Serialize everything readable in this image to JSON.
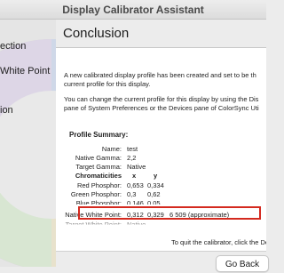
{
  "window": {
    "title": "Display Calibrator Assistant"
  },
  "sidebar": {
    "items": [
      {
        "label": "ection"
      },
      {
        "label": "White Point"
      },
      {
        "label": "ion"
      }
    ]
  },
  "main": {
    "heading": "Conclusion",
    "paragraph1": "A new calibrated display profile has been created and set to be th\ncurrent profile for this display.",
    "paragraph2": "You can change the current profile for this display by using the Dis\npane of System Preferences or the Devices pane of ColorSync Uti",
    "summary": {
      "title": "Profile Summary:",
      "rows": [
        {
          "label": "Name:",
          "values": [
            "test"
          ]
        },
        {
          "label": "Native Gamma:",
          "values": [
            "2,2"
          ]
        },
        {
          "label": "Target Gamma:",
          "values": [
            "Native"
          ]
        },
        {
          "label": "Chromaticities",
          "values": [
            "x",
            "y"
          ]
        },
        {
          "label": "Red Phosphor:",
          "values": [
            "0,653",
            "0,334"
          ]
        },
        {
          "label": "Green Phosphor:",
          "values": [
            "0,3",
            "0,62"
          ]
        },
        {
          "label": "Blue Phosphor:",
          "values": [
            "0,146",
            "0,05"
          ]
        },
        {
          "label": "Native White Point:",
          "values": [
            "0,312",
            "0,329",
            "6 509 (approximate)"
          ]
        },
        {
          "label": "Target White Point:",
          "values": [
            "Native"
          ]
        }
      ]
    },
    "quit_text": "To quit the calibrator, click the Done but"
  },
  "buttons": {
    "go_back": "Go Back"
  },
  "colors": {
    "highlight": "#d42a1f",
    "panel": "#ffffff"
  }
}
